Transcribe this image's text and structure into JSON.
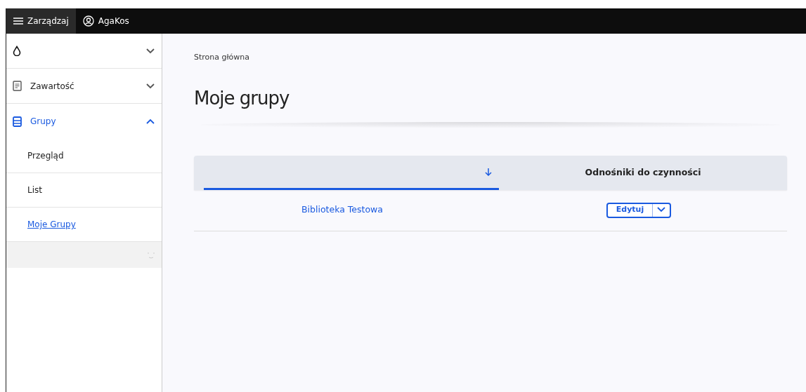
{
  "toolbar": {
    "menu": {
      "label": "Zarządzaj",
      "selected": true
    },
    "user": {
      "label": "AgaKos"
    }
  },
  "sidebar": {
    "items": [
      {
        "kind": "logo",
        "expanded": false
      },
      {
        "kind": "document",
        "label": "Zawartość",
        "expanded": false,
        "selected": false
      },
      {
        "kind": "list",
        "label": "Grupy",
        "expanded": true,
        "selected": true,
        "children": [
          {
            "label": "Przegląd",
            "selected": false
          },
          {
            "label": "List",
            "selected": false
          },
          {
            "label": "Moje Grupy",
            "selected": true
          }
        ]
      }
    ]
  },
  "breadcrumb": "Strona główna",
  "title": "Moje grupy",
  "table": {
    "columns": [
      {
        "sorted": true
      },
      {
        "label": "Odnośniki do czynności",
        "sorted": false
      }
    ],
    "rows": [
      {
        "name": "Biblioteka Testowa",
        "action": "Edytuj"
      }
    ]
  }
}
